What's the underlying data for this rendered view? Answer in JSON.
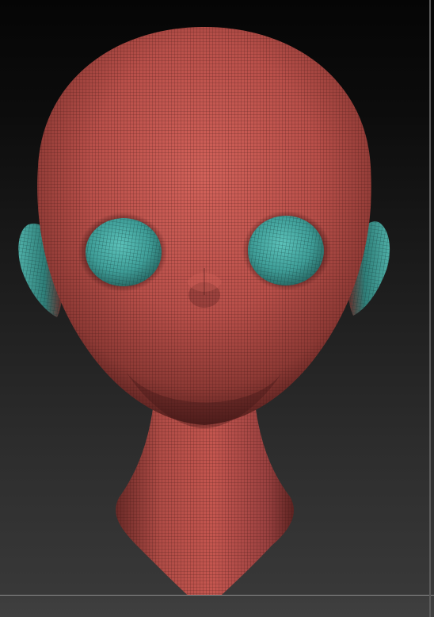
{
  "viewport": {
    "description_label": "",
    "colors": {
      "background_top": "#050505",
      "background_bottom": "#3a3a3a",
      "mesh_base": "#b9504a",
      "mesh_wire": "#3a1412",
      "eye_base": "#3f9e98",
      "eye_wire": "#173a38",
      "frame_edge": "#5a5a5a"
    },
    "model": {
      "type": "polymesh-head",
      "wireframe": true,
      "parts": [
        "head",
        "neck",
        "left-ear",
        "right-ear",
        "left-eye",
        "right-eye"
      ]
    }
  }
}
